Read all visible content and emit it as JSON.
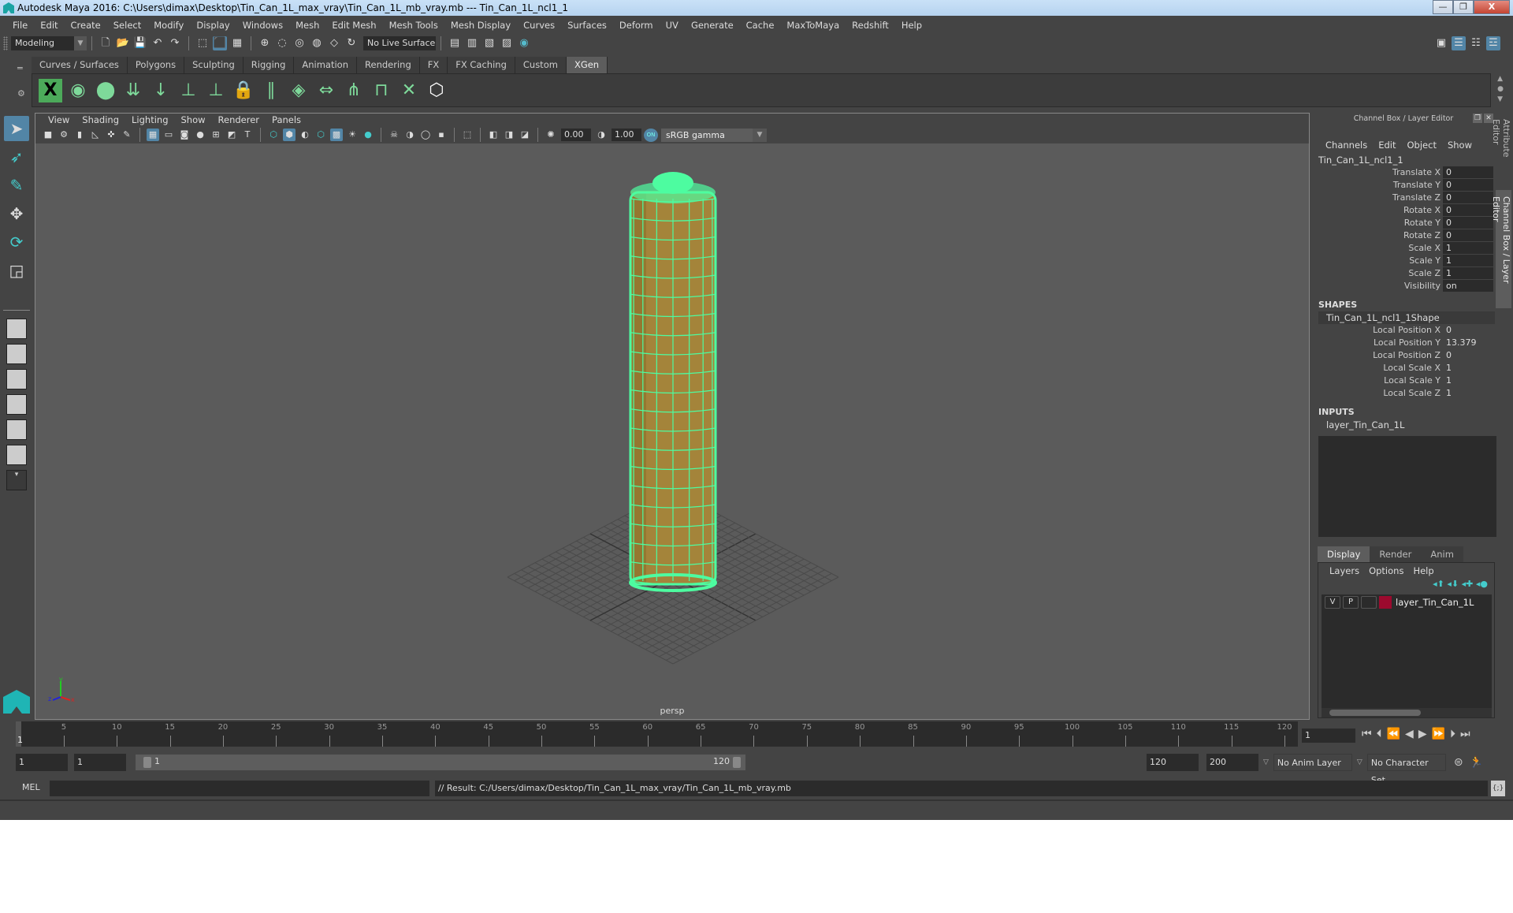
{
  "title": "Autodesk Maya 2016: C:\\Users\\dimax\\Desktop\\Tin_Can_1L_max_vray\\Tin_Can_1L_mb_vray.mb  ---  Tin_Can_1L_ncl1_1",
  "window_buttons": {
    "minimize": "—",
    "restore": "❐",
    "close": "X"
  },
  "menu": [
    "File",
    "Edit",
    "Create",
    "Select",
    "Modify",
    "Display",
    "Windows",
    "Mesh",
    "Edit Mesh",
    "Mesh Tools",
    "Mesh Display",
    "Curves",
    "Surfaces",
    "Deform",
    "UV",
    "Generate",
    "Cache",
    "MaxToMaya",
    "Redshift",
    "Help"
  ],
  "status": {
    "mode": "Modeling",
    "live_surface": "No Live Surface"
  },
  "shelf": {
    "tabs": [
      "Curves / Surfaces",
      "Polygons",
      "Sculpting",
      "Rigging",
      "Animation",
      "Rendering",
      "FX",
      "FX Caching",
      "Custom",
      "XGen"
    ],
    "active_tab": "XGen",
    "icons": [
      "xgen-editor-icon",
      "create-description-icon",
      "delete-description-icon",
      "import-icon",
      "export-icon",
      "add-guide-icon",
      "sculpt-guide-icon",
      "lock-guide-icon",
      "guide-to-curve-icon",
      "interactive-groom-icon",
      "reset-guide-icon",
      "select-guide-icon",
      "guide-preview-icon",
      "delete-guide-icon",
      "xgen-cube-icon"
    ]
  },
  "viewport": {
    "menu": [
      "View",
      "Shading",
      "Lighting",
      "Show",
      "Renderer",
      "Panels"
    ],
    "exposure": "0.00",
    "gamma": "1.00",
    "color_mgmt_on": "ON",
    "color_space": "sRGB gamma",
    "camera": "persp",
    "axis": {
      "x": "x",
      "y": "y",
      "z": "z"
    }
  },
  "channel_box": {
    "header": "Channel Box / Layer Editor",
    "menu": [
      "Channels",
      "Edit",
      "Object",
      "Show"
    ],
    "object": "Tin_Can_1L_ncl1_1",
    "channels": [
      {
        "label": "Translate X",
        "value": "0"
      },
      {
        "label": "Translate Y",
        "value": "0"
      },
      {
        "label": "Translate Z",
        "value": "0"
      },
      {
        "label": "Rotate X",
        "value": "0"
      },
      {
        "label": "Rotate Y",
        "value": "0"
      },
      {
        "label": "Rotate Z",
        "value": "0"
      },
      {
        "label": "Scale X",
        "value": "1"
      },
      {
        "label": "Scale Y",
        "value": "1"
      },
      {
        "label": "Scale Z",
        "value": "1"
      },
      {
        "label": "Visibility",
        "value": "on"
      }
    ],
    "shapes_title": "SHAPES",
    "shape_name": "Tin_Can_1L_ncl1_1Shape",
    "shape_channels": [
      {
        "label": "Local Position X",
        "value": "0"
      },
      {
        "label": "Local Position Y",
        "value": "13.379"
      },
      {
        "label": "Local Position Z",
        "value": "0"
      },
      {
        "label": "Local Scale X",
        "value": "1"
      },
      {
        "label": "Local Scale Y",
        "value": "1"
      },
      {
        "label": "Local Scale Z",
        "value": "1"
      }
    ],
    "inputs_title": "INPUTS",
    "input_name": "layer_Tin_Can_1L"
  },
  "side_tabs": [
    "Attribute Editor",
    "Channel Box / Layer Editor"
  ],
  "layer_editor": {
    "tabs": [
      "Display",
      "Render",
      "Anim"
    ],
    "active_tab": "Display",
    "menu": [
      "Layers",
      "Options",
      "Help"
    ],
    "layers": [
      {
        "v": "V",
        "p": "P",
        "name": "layer_Tin_Can_1L",
        "color": "#9c0a2e"
      }
    ]
  },
  "timeline": {
    "current": "1",
    "ticks": [
      "5",
      "10",
      "15",
      "20",
      "25",
      "30",
      "35",
      "40",
      "45",
      "50",
      "55",
      "60",
      "65",
      "70",
      "75",
      "80",
      "85",
      "90",
      "95",
      "100",
      "105",
      "110",
      "115",
      "120"
    ],
    "current_frame_field": "1"
  },
  "range": {
    "start": "1",
    "anim_start": "1",
    "slider_start": "1",
    "slider_end": "120",
    "anim_end": "120",
    "end": "200",
    "anim_layer": "No Anim Layer",
    "char_set": "No Character Set"
  },
  "command": {
    "label": "MEL",
    "result": "// Result: C:/Users/dimax/Desktop/Tin_Can_1L_max_vray/Tin_Can_1L_mb_vray.mb"
  },
  "colors": {
    "accent": "#5285a6",
    "wire": "#4dfca0",
    "can": "#a8873a",
    "layer": "#9c0a2e"
  }
}
